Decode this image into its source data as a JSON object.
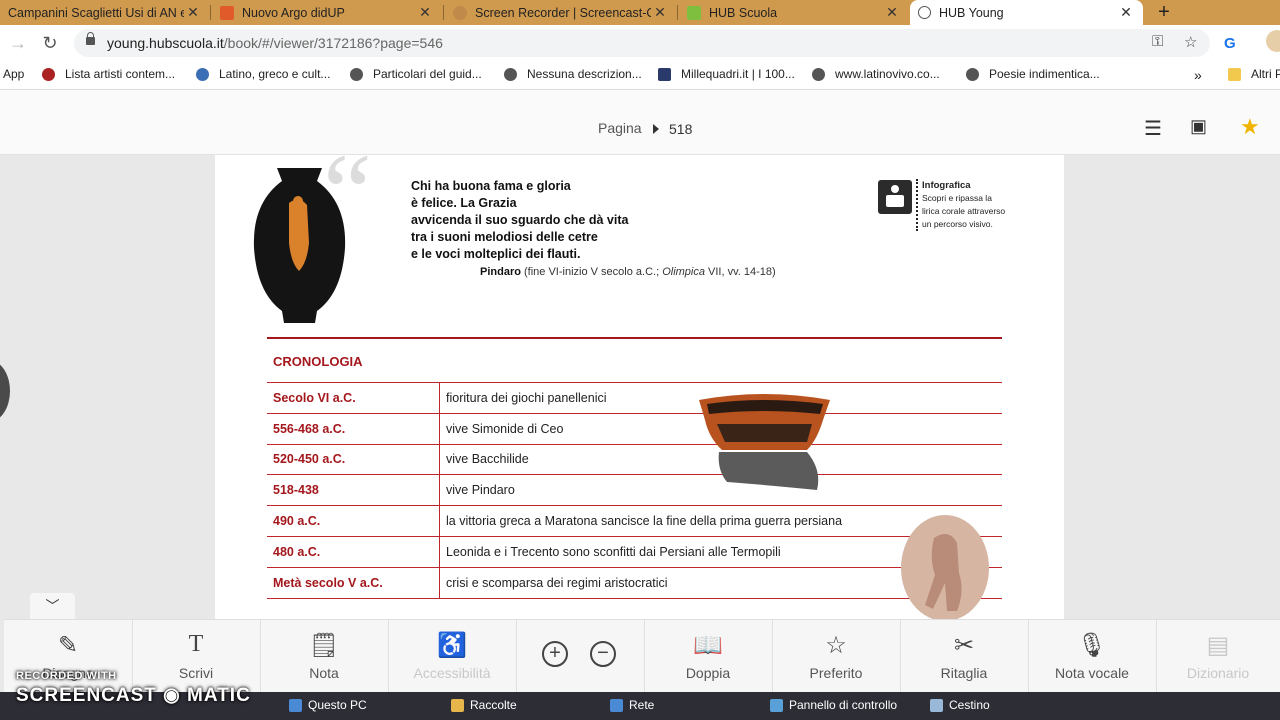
{
  "browser": {
    "tabs": [
      {
        "title": "Campanini Scaglietti Usi di AN e",
        "favicon_color": "#7a5a2a"
      },
      {
        "title": "Nuovo Argo didUP",
        "favicon_color": "#e05a2a"
      },
      {
        "title": "Screen Recorder | Screencast-O",
        "favicon_color": "#c08a4a"
      },
      {
        "title": "HUB Scuola",
        "favicon_color": "#7fbf3f"
      },
      {
        "title": "HUB Young",
        "favicon_color": "#555555",
        "active": true
      }
    ],
    "url_host": "young.hubscuola.it",
    "url_path": "/book/#/viewer/3172186?page=546",
    "bookmarks": [
      {
        "label": "App",
        "icon": "apps-icon"
      },
      {
        "label": "Lista artisti contem...",
        "icon": "person-icon"
      },
      {
        "label": "Latino, greco e cult...",
        "icon": "globe-icon"
      },
      {
        "label": "Particolari del guid...",
        "icon": "globe-icon"
      },
      {
        "label": "Nessuna descrizion...",
        "icon": "globe-icon"
      },
      {
        "label": "Millequadri.it | I 100...",
        "icon": "mq-icon"
      },
      {
        "label": "www.latinovivo.co...",
        "icon": "globe-icon"
      },
      {
        "label": "Poesie indimentica...",
        "icon": "globe-icon"
      },
      {
        "label": "Altri P",
        "icon": "folder-icon"
      }
    ],
    "bookmarks_overflow": "»"
  },
  "viewer": {
    "page_label": "Pagina",
    "page_number": "518"
  },
  "book": {
    "quote_lines": [
      "Chi ha buona fama e gloria",
      "è felice. La Grazia",
      "avvicenda il suo sguardo che dà vita",
      "tra i suoni melodiosi delle cetre",
      "e le voci molteplici dei flauti."
    ],
    "quote_author": "Pindaro",
    "quote_source_pre": "(fine VI-inizio V secolo a.C.; ",
    "quote_source_work": "Olimpica",
    "quote_source_post": " VII, vv. 14-18)",
    "info_title": "Infografica",
    "info_lines": [
      "Scopri e ripassa la",
      "lirica corale attraverso",
      "un percorso visivo."
    ],
    "chronology_title": "CRONOLOGIA",
    "chronology": [
      {
        "date": "Secolo VI a.C.",
        "event": "fioritura dei giochi panellenici"
      },
      {
        "date": "556-468 a.C.",
        "event": "vive Simonide di Ceo"
      },
      {
        "date": "520-450 a.C.",
        "event": "vive Bacchilide"
      },
      {
        "date": "518-438",
        "event": "vive Pindaro"
      },
      {
        "date": "490 a.C.",
        "event": "la vittoria greca a Maratona sancisce la fine della prima guerra persiana"
      },
      {
        "date": "480 a.C.",
        "event": "Leonida e i Trecento sono sconfitti dai Persiani alle Termopili"
      },
      {
        "date": "Metà secolo V a.C.",
        "event": "crisi e scomparsa dei regimi aristocratici"
      }
    ]
  },
  "toolbar": {
    "tools": [
      {
        "label": "Disegna",
        "icon": "pencil-icon",
        "disabled": false
      },
      {
        "label": "Scrivi",
        "icon": "text-icon",
        "disabled": false
      },
      {
        "label": "Nota",
        "icon": "note-icon",
        "disabled": false
      },
      {
        "label": "Accessibilità",
        "icon": "accessibility-icon",
        "disabled": true
      },
      {
        "label": "Doppia",
        "icon": "book-icon",
        "disabled": false
      },
      {
        "label": "Preferito",
        "icon": "star-icon",
        "disabled": false
      },
      {
        "label": "Ritaglia",
        "icon": "scissors-icon",
        "disabled": false
      },
      {
        "label": "Nota vocale",
        "icon": "microphone-icon",
        "disabled": false
      },
      {
        "label": "Dizionario",
        "icon": "dictionary-icon",
        "disabled": true
      }
    ]
  },
  "taskbar": {
    "items": [
      "Questo PC",
      "Raccolte",
      "Rete",
      "Pannello di controllo",
      "Cestino"
    ]
  },
  "watermark": {
    "line1": "RECORDED WITH",
    "line2": "SCREENCAST",
    "line3": "MATIC"
  },
  "colors": {
    "tab_strip": "#d09a4e",
    "accent_red": "#a4171c",
    "star": "#f0b400"
  }
}
